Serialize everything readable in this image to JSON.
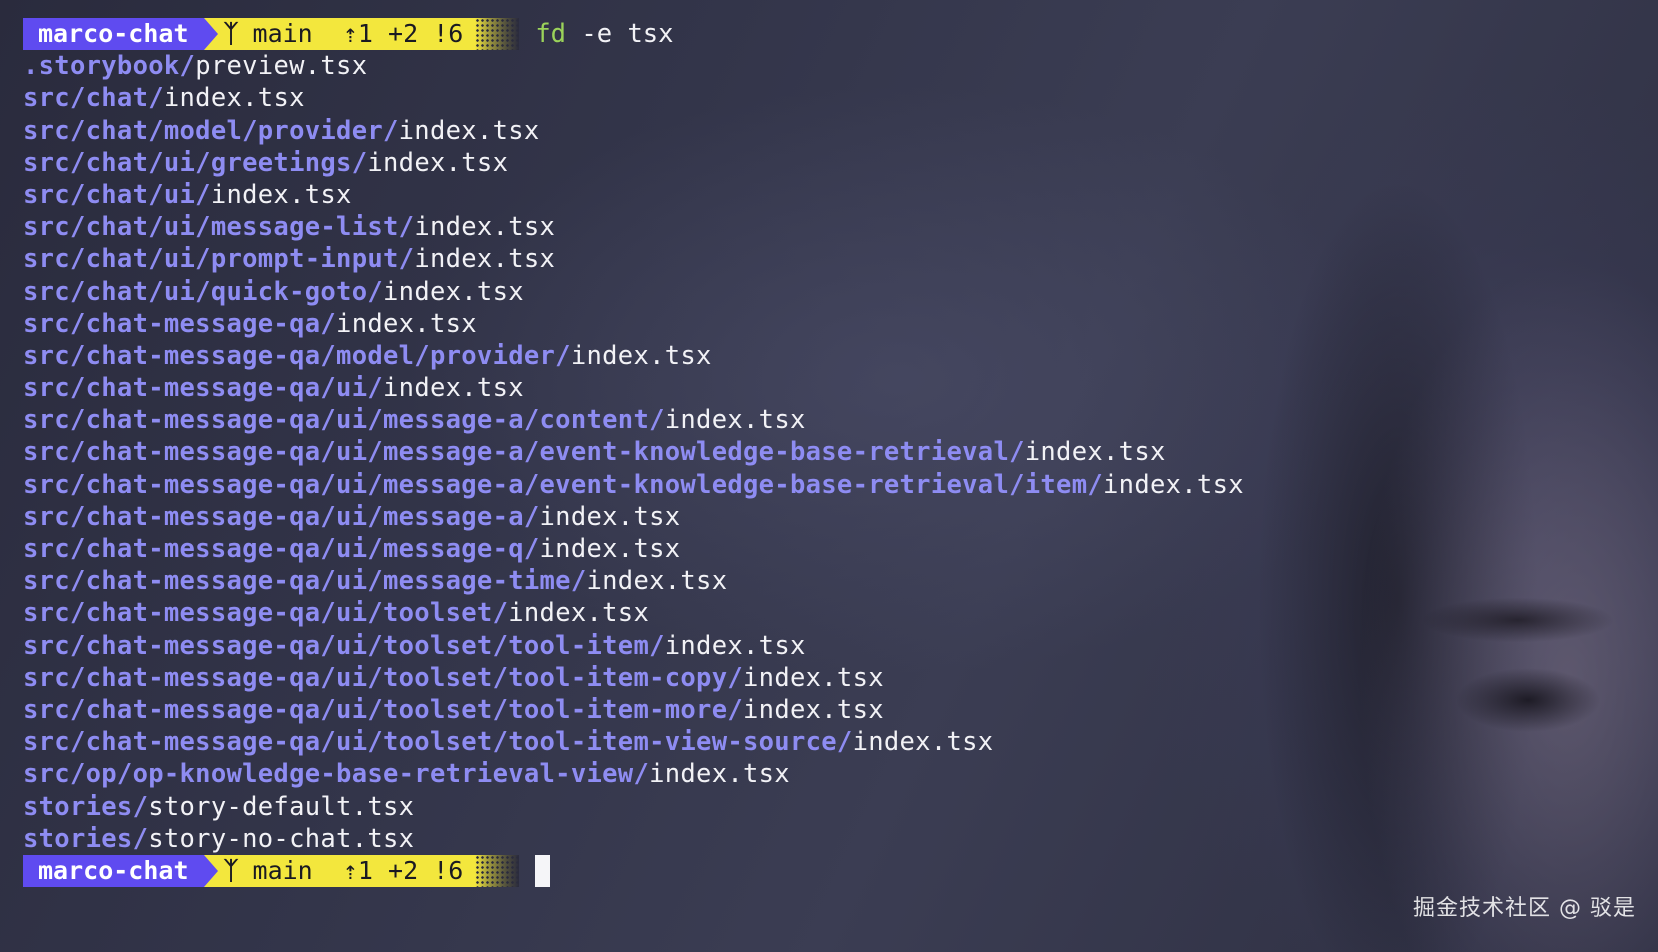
{
  "prompt": {
    "repo": "marco-chat",
    "branch_icon": "ᛉ",
    "branch": "main",
    "status": [
      "⇡1",
      "+2",
      "!6"
    ]
  },
  "command": {
    "name": "fd",
    "args": " -e tsx"
  },
  "output": [
    {
      "dir": ".storybook/",
      "file": "preview.tsx"
    },
    {
      "dir": "src/chat/",
      "file": "index.tsx"
    },
    {
      "dir": "src/chat/model/provider/",
      "file": "index.tsx"
    },
    {
      "dir": "src/chat/ui/greetings/",
      "file": "index.tsx"
    },
    {
      "dir": "src/chat/ui/",
      "file": "index.tsx"
    },
    {
      "dir": "src/chat/ui/message-list/",
      "file": "index.tsx"
    },
    {
      "dir": "src/chat/ui/prompt-input/",
      "file": "index.tsx"
    },
    {
      "dir": "src/chat/ui/quick-goto/",
      "file": "index.tsx"
    },
    {
      "dir": "src/chat-message-qa/",
      "file": "index.tsx"
    },
    {
      "dir": "src/chat-message-qa/model/provider/",
      "file": "index.tsx"
    },
    {
      "dir": "src/chat-message-qa/ui/",
      "file": "index.tsx"
    },
    {
      "dir": "src/chat-message-qa/ui/message-a/content/",
      "file": "index.tsx"
    },
    {
      "dir": "src/chat-message-qa/ui/message-a/event-knowledge-base-retrieval/",
      "file": "index.tsx"
    },
    {
      "dir": "src/chat-message-qa/ui/message-a/event-knowledge-base-retrieval/item/",
      "file": "index.tsx"
    },
    {
      "dir": "src/chat-message-qa/ui/message-a/",
      "file": "index.tsx"
    },
    {
      "dir": "src/chat-message-qa/ui/message-q/",
      "file": "index.tsx"
    },
    {
      "dir": "src/chat-message-qa/ui/message-time/",
      "file": "index.tsx"
    },
    {
      "dir": "src/chat-message-qa/ui/toolset/",
      "file": "index.tsx"
    },
    {
      "dir": "src/chat-message-qa/ui/toolset/tool-item/",
      "file": "index.tsx"
    },
    {
      "dir": "src/chat-message-qa/ui/toolset/tool-item-copy/",
      "file": "index.tsx"
    },
    {
      "dir": "src/chat-message-qa/ui/toolset/tool-item-more/",
      "file": "index.tsx"
    },
    {
      "dir": "src/chat-message-qa/ui/toolset/tool-item-view-source/",
      "file": "index.tsx"
    },
    {
      "dir": "src/op/op-knowledge-base-retrieval-view/",
      "file": "index.tsx"
    },
    {
      "dir": "stories/",
      "file": "story-default.tsx"
    },
    {
      "dir": "stories/",
      "file": "story-no-chat.tsx"
    }
  ],
  "watermark": "掘金技术社区 @ 驳是",
  "colors": {
    "repo_segment": "#5f4bf0",
    "git_segment": "#f3e73d",
    "directory": "#8e8cf2",
    "command": "#9bd35a"
  }
}
